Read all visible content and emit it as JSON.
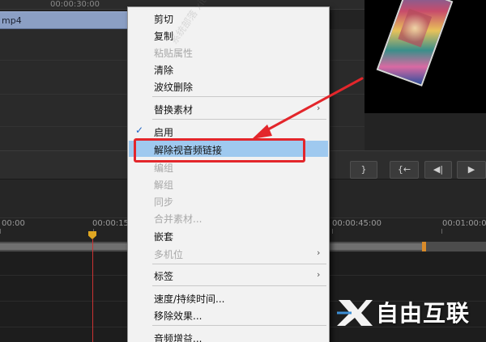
{
  "timeline_top": {
    "clip_name": "mp4",
    "timecode_top": "00:00:30:00"
  },
  "monitor_controls": {
    "brace_label": "}",
    "step_back_label": "{←",
    "prev_frame_label": "◀|",
    "play_label": "▶"
  },
  "timeline": {
    "timecodes": [
      "00:00",
      "00:00:15",
      "00:00:45:00",
      "00:01:00:0"
    ]
  },
  "context_menu": {
    "items": [
      {
        "label": "剪切"
      },
      {
        "label": "复制"
      },
      {
        "label": "粘贴属性"
      },
      {
        "label": "清除"
      },
      {
        "label": "波纹删除"
      },
      {
        "label": "替换素材"
      },
      {
        "label": "启用"
      },
      {
        "label": "解除视音频链接"
      },
      {
        "label": "编组"
      },
      {
        "label": "解组"
      },
      {
        "label": "同步"
      },
      {
        "label": "合并素材..."
      },
      {
        "label": "嵌套"
      },
      {
        "label": "多机位"
      },
      {
        "label": "标签"
      },
      {
        "label": "速度/持续时间..."
      },
      {
        "label": "移除效果..."
      },
      {
        "label": "音频增益..."
      }
    ],
    "submenu_arrow": "›",
    "check_glyph": "✓"
  },
  "watermark": {
    "text": "系统部落 xitongbuluo.com"
  },
  "logo": {
    "text": "自由互联"
  },
  "colors": {
    "highlight": "#9fc9ef",
    "annotation_red": "#e3262b",
    "clip_blue": "#8b9fc4"
  }
}
